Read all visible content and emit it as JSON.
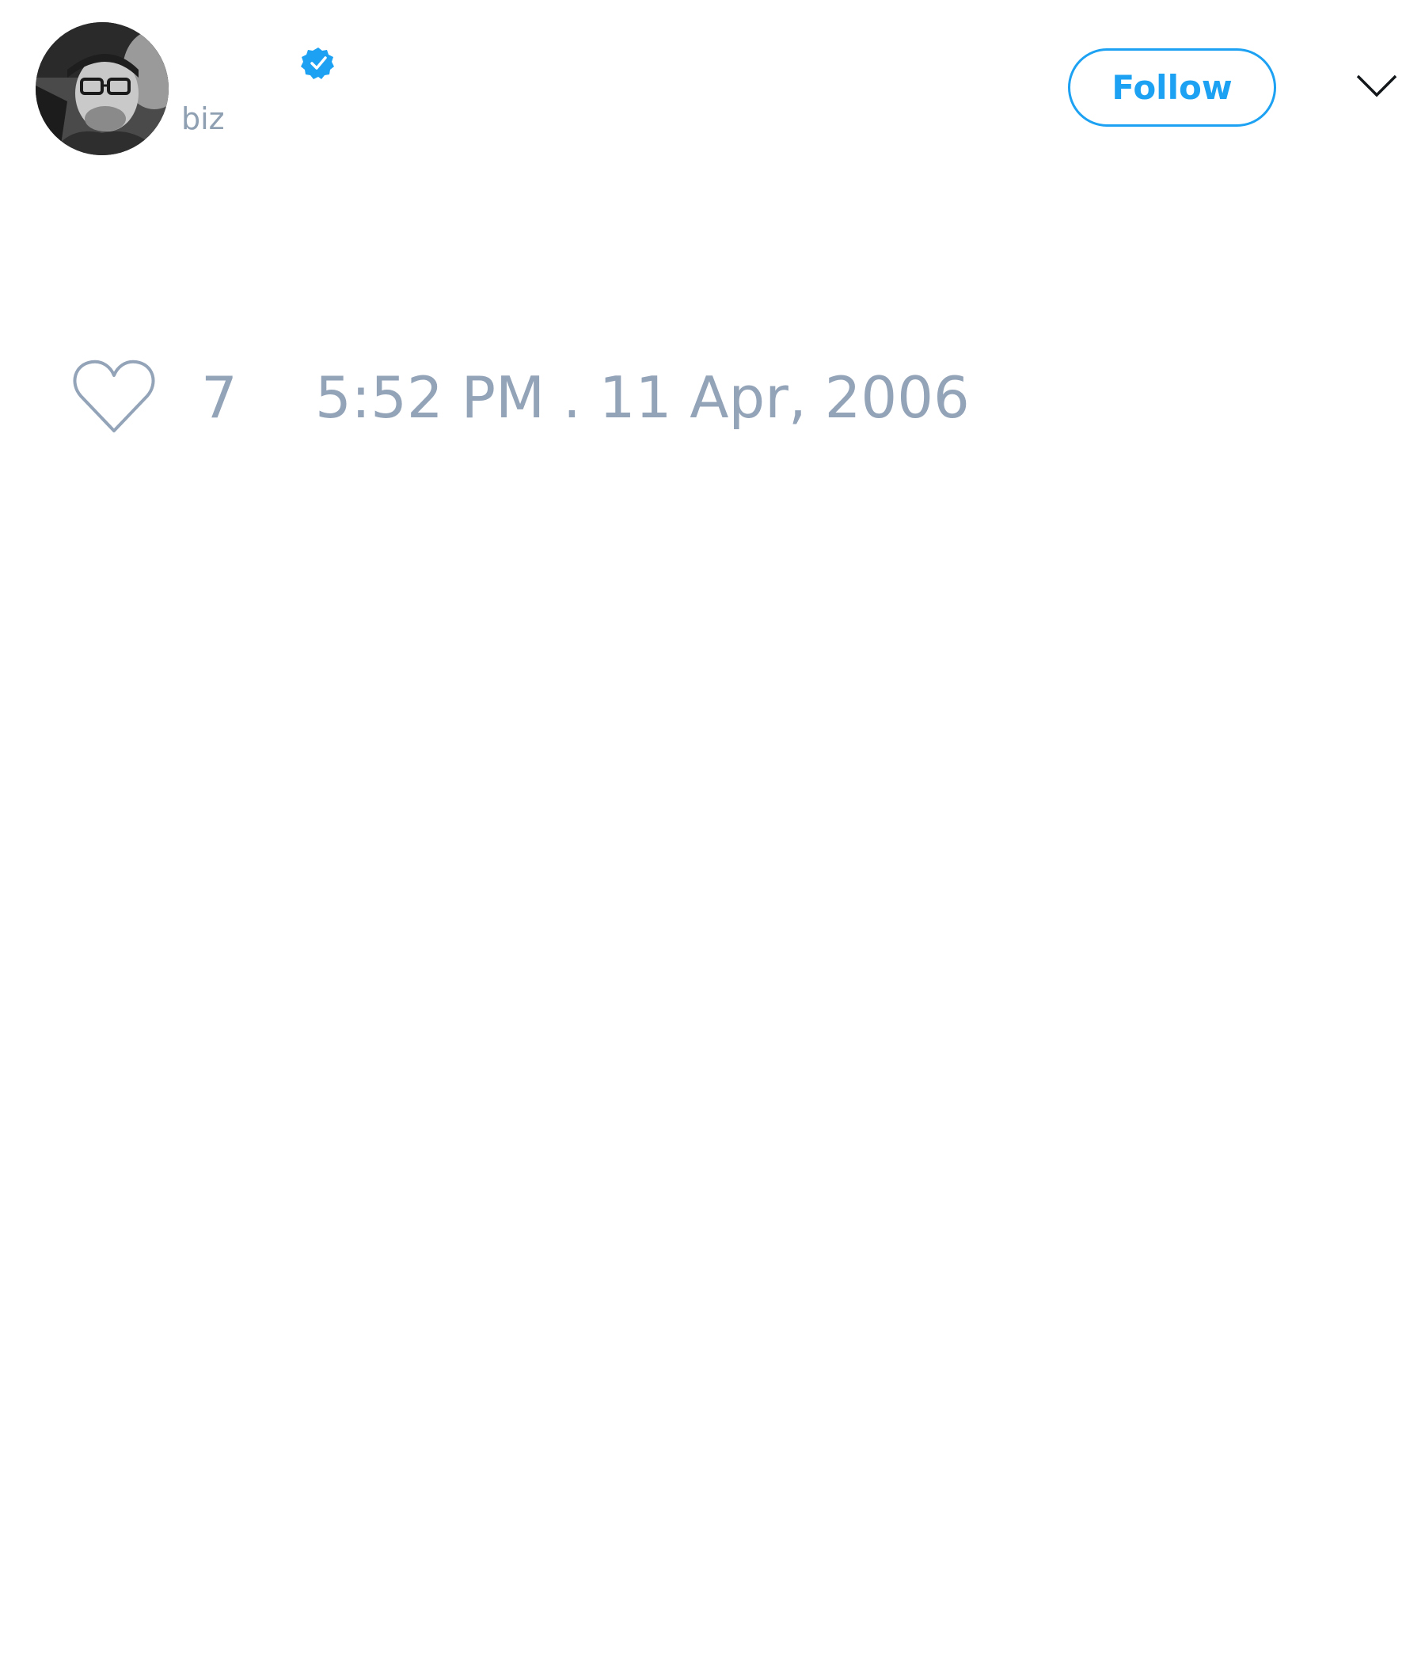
{
  "tweet": {
    "author": {
      "display_name": "",
      "handle": "biz",
      "verified": true,
      "avatar_icon": "profile-photo"
    },
    "follow_label": "Follow",
    "likes": "7",
    "timestamp": "5:52 PM . 11 Apr, 2006"
  },
  "icons": {
    "verified": "verified-badge-icon",
    "menu": "chevron-down-icon",
    "like": "heart-outline-icon"
  },
  "colors": {
    "accent": "#1da1f2",
    "muted_text": "#93a3b8",
    "background": "#ffffff"
  }
}
